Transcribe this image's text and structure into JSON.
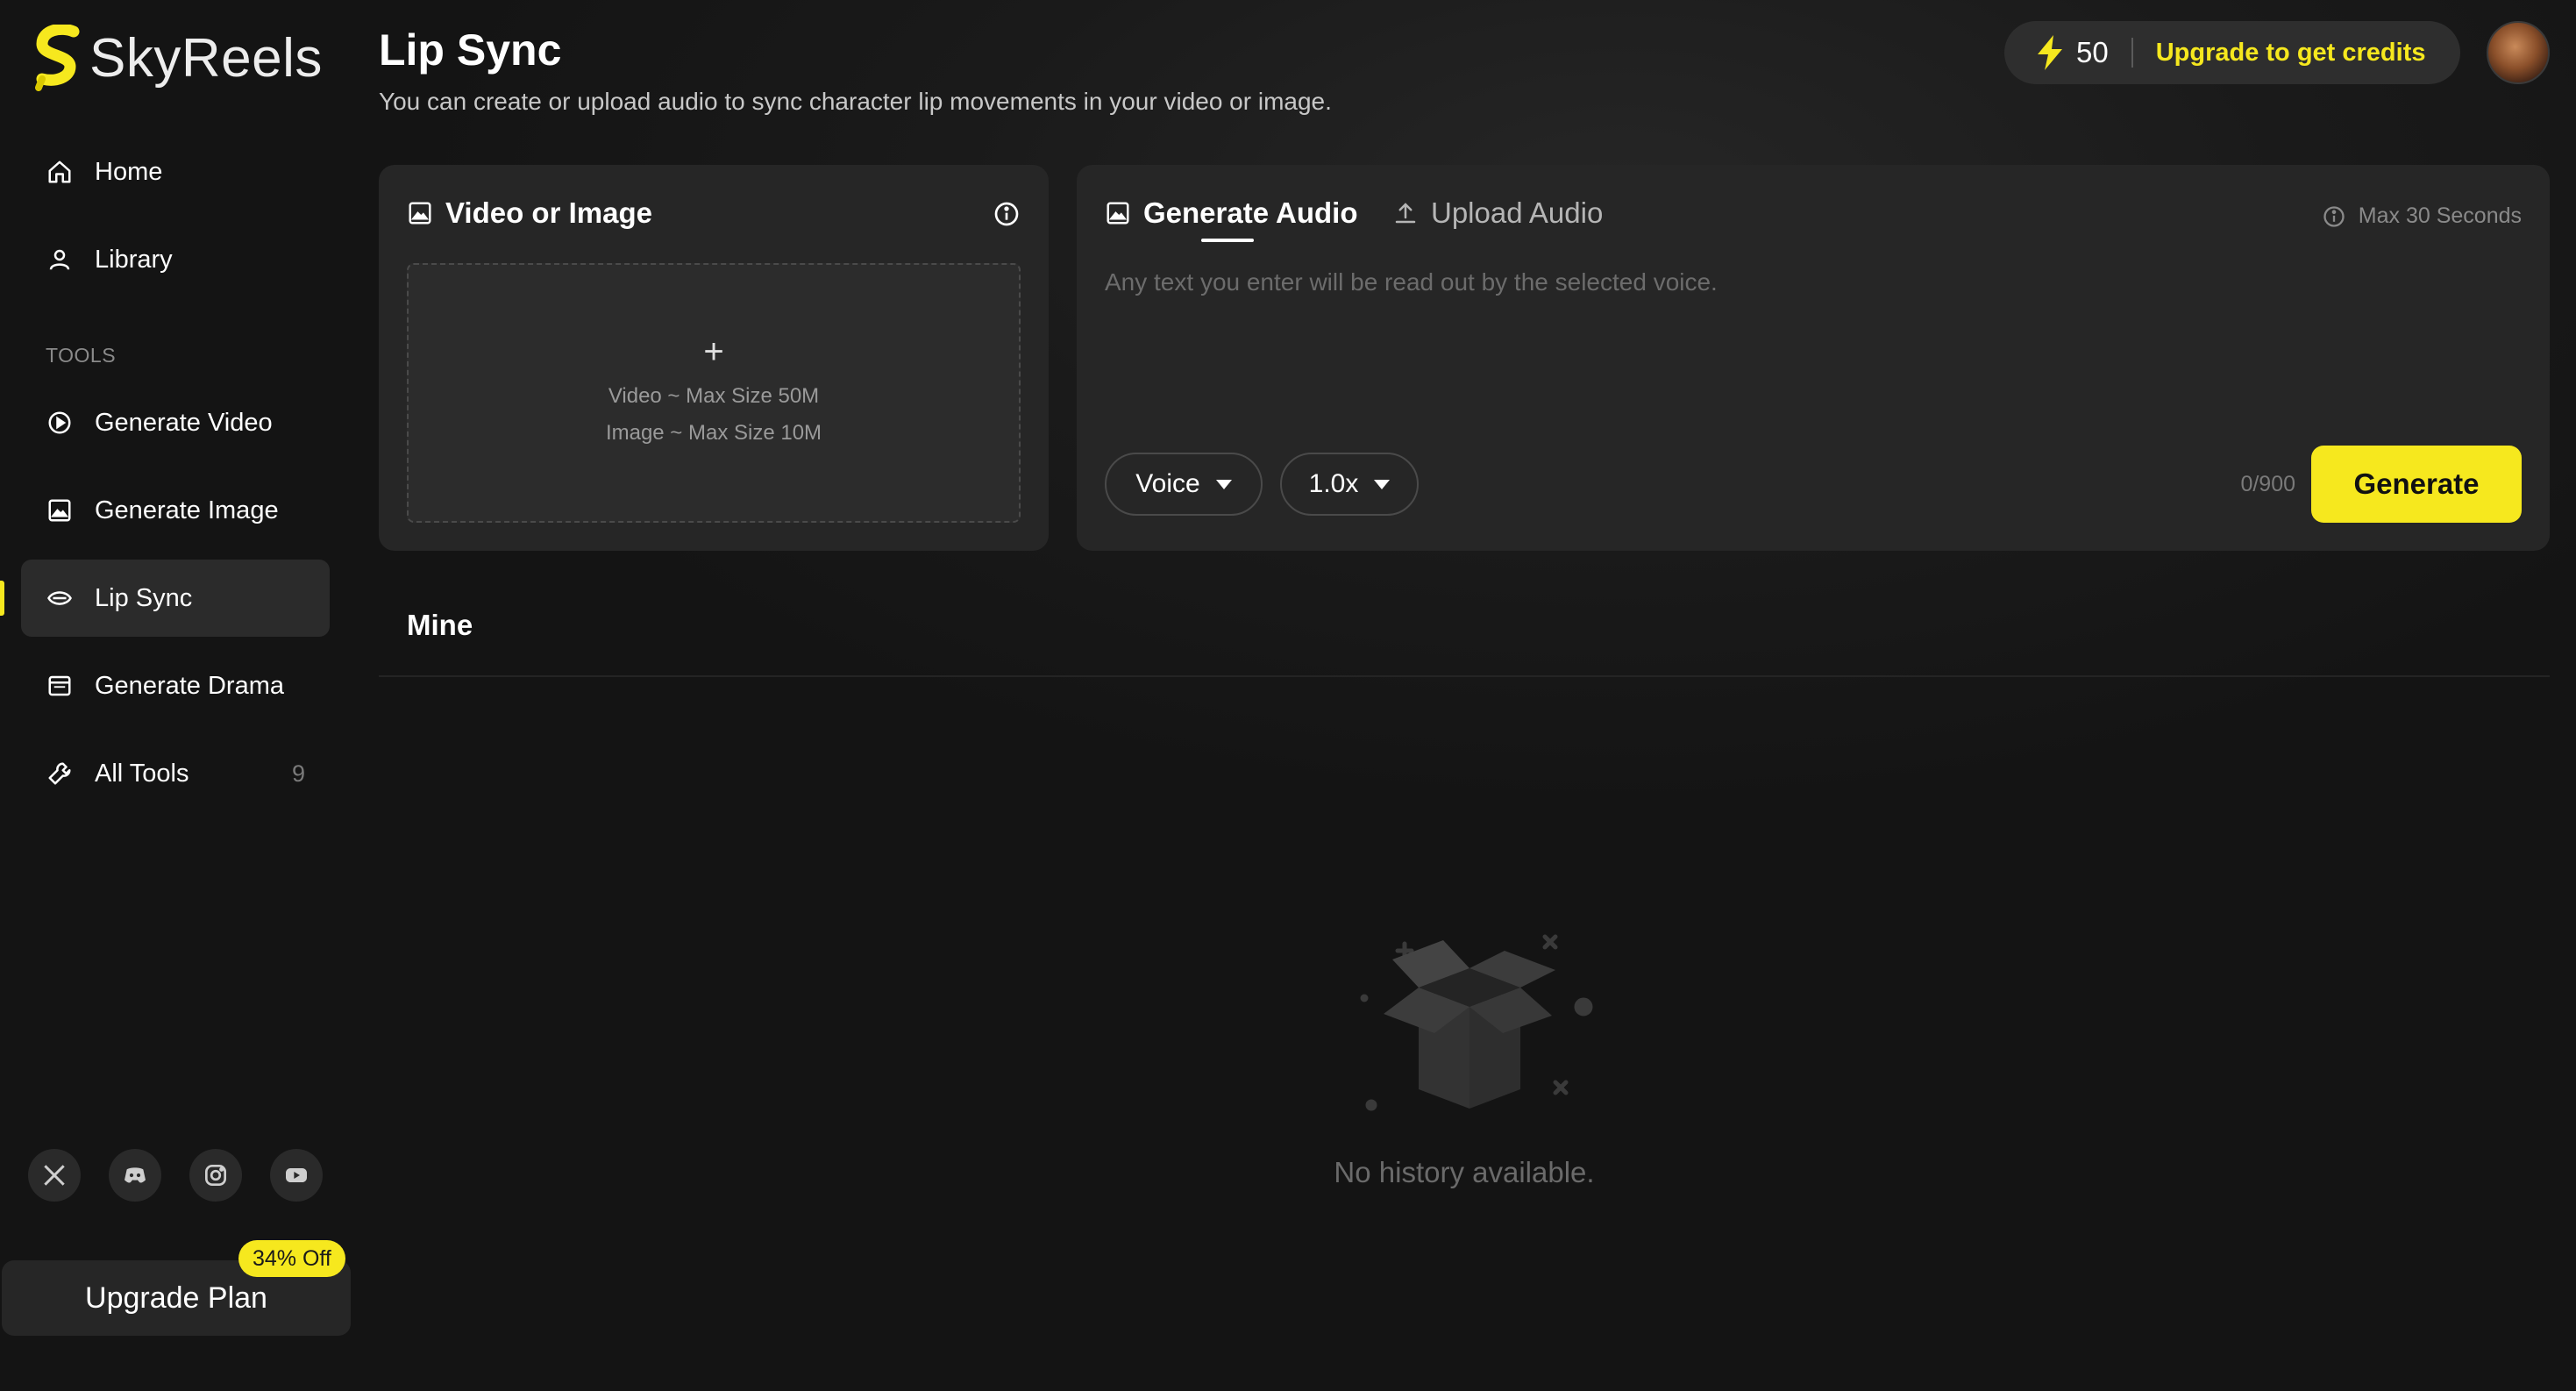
{
  "brand": {
    "name": "SkyReels",
    "accent": "#f6e81e"
  },
  "sidebar": {
    "nav": [
      {
        "label": "Home",
        "icon": "home-icon"
      },
      {
        "label": "Library",
        "icon": "user-icon"
      }
    ],
    "tools_label": "TOOLS",
    "tools": [
      {
        "label": "Generate Video",
        "icon": "play-circle-icon"
      },
      {
        "label": "Generate Image",
        "icon": "image-icon"
      },
      {
        "label": "Lip Sync",
        "icon": "lips-icon",
        "active": true
      },
      {
        "label": "Generate Drama",
        "icon": "drama-icon"
      },
      {
        "label": "All Tools",
        "icon": "wrench-icon",
        "count": "9"
      }
    ],
    "socials": [
      "x-icon",
      "discord-icon",
      "instagram-icon",
      "youtube-icon"
    ],
    "upgrade": {
      "label": "Upgrade Plan",
      "badge": "34% Off"
    }
  },
  "header": {
    "title": "Lip Sync",
    "subtitle": "You can create or upload audio to sync character lip movements in your video or image.",
    "credits": "50",
    "upgrade_label": "Upgrade to get credits"
  },
  "video_card": {
    "title": "Video or Image",
    "plus": "+",
    "video_limit": "Video ~ Max Size 50M",
    "image_limit": "Image ~ Max Size 10M"
  },
  "audio_card": {
    "tabs": [
      {
        "label": "Generate Audio",
        "active": true
      },
      {
        "label": "Upload Audio",
        "active": false
      }
    ],
    "max_duration": "Max 30 Seconds",
    "placeholder": "Any text you enter will be read out by the selected voice.",
    "voice_label": "Voice",
    "speed_label": "1.0x",
    "char_count": "0/900",
    "generate_label": "Generate"
  },
  "mine": {
    "title": "Mine",
    "empty_text": "No history available."
  }
}
